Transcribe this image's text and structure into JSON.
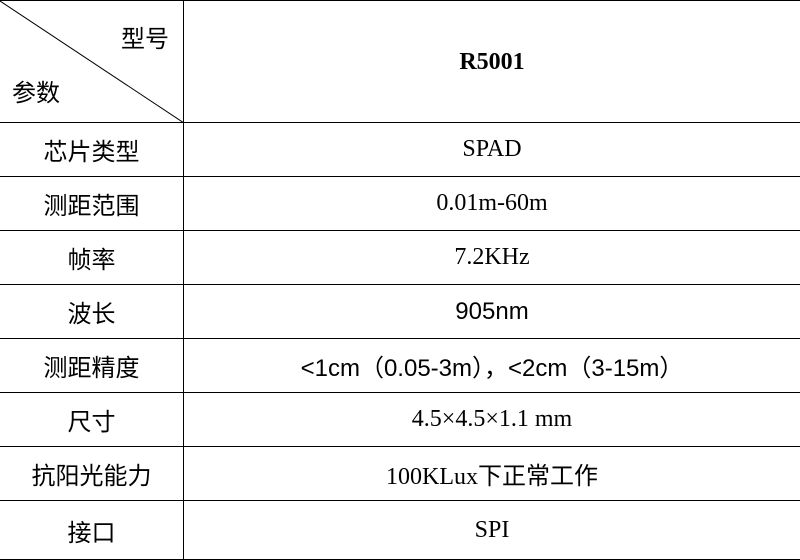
{
  "header": {
    "model_label": "型号",
    "param_label": "参数",
    "model_value": "R5001"
  },
  "rows": [
    {
      "name": "芯片类型",
      "value": "SPAD"
    },
    {
      "name": "测距范围",
      "value": "0.01m-60m"
    },
    {
      "name": "帧率",
      "value": "7.2KHz"
    },
    {
      "name": "波长",
      "value": "905nm"
    },
    {
      "name": "测距精度",
      "value": "<1cm（0.05-3m），<2cm（3-15m）"
    },
    {
      "name": "尺寸",
      "value": "4.5×4.5×1.1 mm"
    },
    {
      "name": "抗阳光能力",
      "value": "100KLux下正常工作"
    },
    {
      "name": "接口",
      "value": "SPI"
    }
  ]
}
